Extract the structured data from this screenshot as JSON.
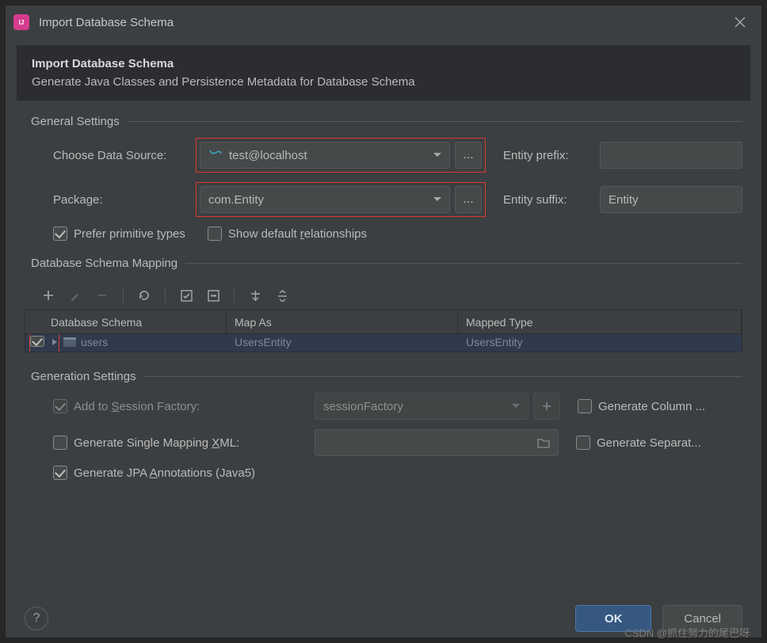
{
  "window": {
    "title": "Import Database Schema"
  },
  "banner": {
    "heading": "Import Database Schema",
    "subheading": "Generate Java Classes and Persistence Metadata for Database Schema"
  },
  "general": {
    "section_title": "General Settings",
    "data_source_label": "Choose Data Source:",
    "data_source_value": "test@localhost",
    "package_label": "Package:",
    "package_value": "com.Entity",
    "entity_prefix_label": "Entity prefix:",
    "entity_prefix_value": "",
    "entity_suffix_label": "Entity suffix:",
    "entity_suffix_value": "Entity",
    "prefer_primitive_label_pre": "Prefer primitive ",
    "prefer_primitive_label_u": "t",
    "prefer_primitive_label_post": "ypes",
    "prefer_primitive_checked": true,
    "show_default_rel_label_pre": "Show default ",
    "show_default_rel_label_u": "r",
    "show_default_rel_label_post": "elationships",
    "show_default_rel_checked": false
  },
  "mapping": {
    "section_title": "Database Schema Mapping",
    "col_schema": "Database Schema",
    "col_map_as": "Map As",
    "col_mapped_type": "Mapped Type",
    "row": {
      "schema": "users",
      "map_as": "UsersEntity",
      "mapped_type": "UsersEntity"
    }
  },
  "generation": {
    "section_title": "Generation Settings",
    "add_session_label_pre": "Add to ",
    "add_session_label_u": "S",
    "add_session_label_post": "ession Factory:",
    "add_session_checked": true,
    "session_value": "sessionFactory",
    "generate_column_label": "Generate Column ...",
    "generate_column_checked": false,
    "single_xml_label_pre": "Generate Single Mapping ",
    "single_xml_label_u": "X",
    "single_xml_label_post": "ML:",
    "single_xml_checked": false,
    "single_xml_value": "",
    "generate_separate_label": "Generate Separat...",
    "generate_separate_checked": false,
    "jpa_label_pre": "Generate JPA ",
    "jpa_label_u": "A",
    "jpa_label_post": "nnotations (Java5)",
    "jpa_checked": true
  },
  "buttons": {
    "ok": "OK",
    "cancel": "Cancel"
  },
  "watermark": "CSDN @抓住努力的尾巴呀"
}
